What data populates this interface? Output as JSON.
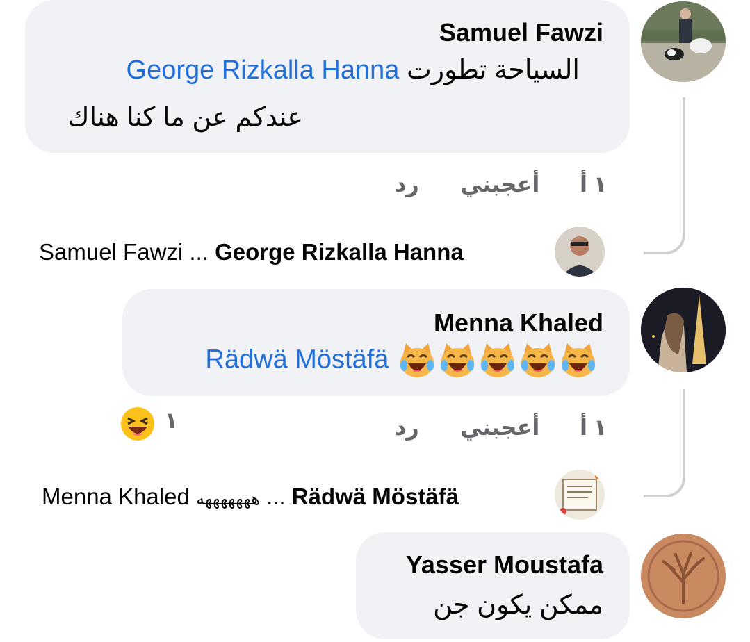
{
  "comments": [
    {
      "author": "Samuel Fawzi",
      "mention": "George Rizkalla Hanna",
      "text_line1": "السياحة تطورت",
      "text_line2": "عندكم عن ما كنا هناك",
      "time": "١ أ",
      "like_label": "أعجبني",
      "reply_label": "رد",
      "reply_preview": {
        "author": "George Rizkalla Hanna",
        "ellipsis": "...",
        "text": "Samuel Fawzi"
      }
    },
    {
      "author": "Menna Khaled",
      "mention": "Rädwä Möstäfä",
      "emoji_count": 5,
      "time": "١ أ",
      "like_label": "أعجبني",
      "reply_label": "رد",
      "reaction_count": "١",
      "reply_preview": {
        "author": "Rädwä Möstäfä",
        "ellipsis": "...",
        "laugh": "هههههههه",
        "text": "Menna Khaled"
      }
    },
    {
      "author": "Yasser Moustafa",
      "text_line1": "ممكن يكون جن"
    }
  ],
  "colors": {
    "bubble": "#f0f2f5",
    "mention": "#216fdb",
    "meta": "#65676b",
    "thread_line": "#ced0d4"
  }
}
